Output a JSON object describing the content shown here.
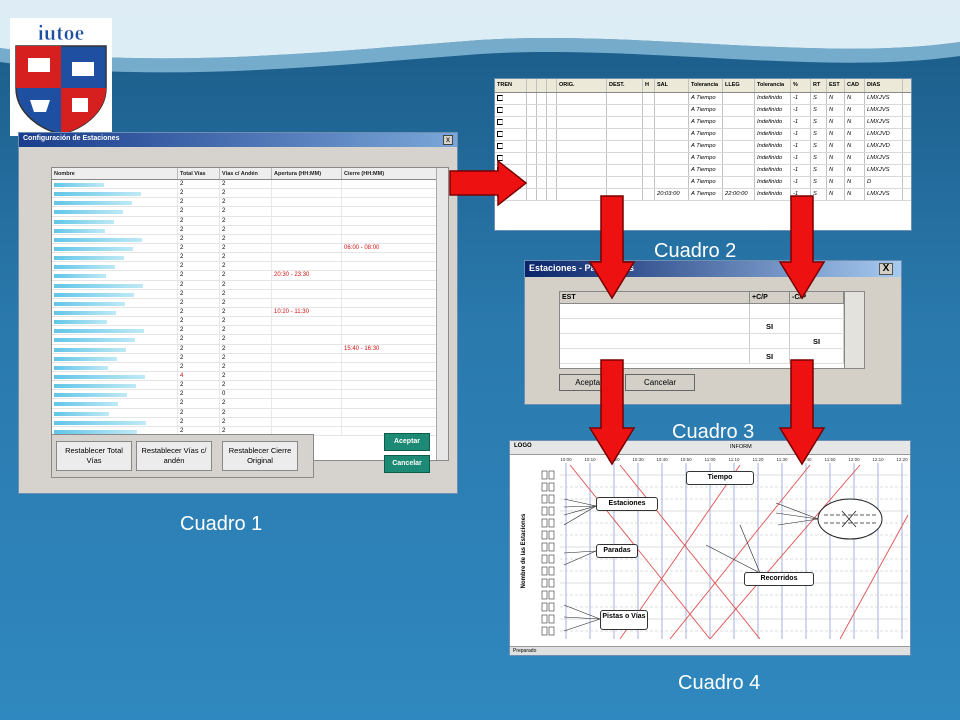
{
  "captions": {
    "c1": "Cuadro 1",
    "c2": "Cuadro 2",
    "c3": "Cuadro 3",
    "c4": "Cuadro 4"
  },
  "logo": {
    "text": "iutoe"
  },
  "cuadro1": {
    "title": "Configuración de Estaciones",
    "close_glyph": "x",
    "columns": [
      "Nombre",
      "Total Vías",
      "Vías c/ Andén",
      "Apertura (HH:MM)",
      "Cierre (HH:MM)"
    ],
    "rows": [
      {
        "total": "2",
        "via": "2",
        "apertura": "",
        "cierre": "",
        "red": false
      },
      {
        "total": "2",
        "via": "2",
        "apertura": "",
        "cierre": "",
        "red": false
      },
      {
        "total": "2",
        "via": "2",
        "apertura": "",
        "cierre": "",
        "red": false
      },
      {
        "total": "2",
        "via": "2",
        "apertura": "",
        "cierre": "",
        "red": false
      },
      {
        "total": "2",
        "via": "2",
        "apertura": "",
        "cierre": "",
        "red": false
      },
      {
        "total": "2",
        "via": "2",
        "apertura": "",
        "cierre": "",
        "red": false
      },
      {
        "total": "2",
        "via": "2",
        "apertura": "",
        "cierre": "",
        "red": false
      },
      {
        "total": "2",
        "via": "2",
        "apertura": "",
        "cierre": "06:00 - 08:00",
        "red": false
      },
      {
        "total": "2",
        "via": "2",
        "apertura": "",
        "cierre": "",
        "red": false
      },
      {
        "total": "2",
        "via": "2",
        "apertura": "",
        "cierre": "",
        "red": false
      },
      {
        "total": "2",
        "via": "2",
        "apertura": "20:30 - 23:30",
        "cierre": "",
        "red": false
      },
      {
        "total": "2",
        "via": "2",
        "apertura": "",
        "cierre": "",
        "red": false
      },
      {
        "total": "2",
        "via": "2",
        "apertura": "",
        "cierre": "",
        "red": false
      },
      {
        "total": "2",
        "via": "2",
        "apertura": "",
        "cierre": "",
        "red": false
      },
      {
        "total": "2",
        "via": "2",
        "apertura": "10:20 - 11:30",
        "cierre": "",
        "red": false
      },
      {
        "total": "2",
        "via": "2",
        "apertura": "",
        "cierre": "",
        "red": false
      },
      {
        "total": "2",
        "via": "2",
        "apertura": "",
        "cierre": "",
        "red": false
      },
      {
        "total": "2",
        "via": "2",
        "apertura": "",
        "cierre": "",
        "red": false
      },
      {
        "total": "2",
        "via": "2",
        "apertura": "",
        "cierre": "15:40 - 16:30",
        "red": false
      },
      {
        "total": "2",
        "via": "2",
        "apertura": "",
        "cierre": "",
        "red": false
      },
      {
        "total": "2",
        "via": "2",
        "apertura": "",
        "cierre": "",
        "red": false
      },
      {
        "total": "4",
        "via": "2",
        "apertura": "",
        "cierre": "",
        "red": true
      },
      {
        "total": "2",
        "via": "2",
        "apertura": "",
        "cierre": "",
        "red": false
      },
      {
        "total": "2",
        "via": "0",
        "apertura": "",
        "cierre": "",
        "red": false
      },
      {
        "total": "2",
        "via": "2",
        "apertura": "",
        "cierre": "",
        "red": false
      },
      {
        "total": "2",
        "via": "2",
        "apertura": "",
        "cierre": "",
        "red": false
      },
      {
        "total": "2",
        "via": "2",
        "apertura": "",
        "cierre": "",
        "red": false
      },
      {
        "total": "2",
        "via": "2",
        "apertura": "",
        "cierre": "",
        "red": false
      }
    ],
    "buttons": {
      "restablecer_total": "Restablecer Total Vías",
      "restablecer_vias": "Restablecer Vías c/ andén",
      "restablecer_cierre": "Restablecer Cierre Original",
      "aceptar": "Aceptar",
      "cancelar": "Cancelar"
    }
  },
  "cuadro2": {
    "columns": [
      "TREN",
      "",
      "",
      "",
      "ORIG.",
      "DEST.",
      "H",
      "SAL",
      "Tolerancia",
      "LLEG",
      "Tolerancia",
      "%",
      "RT",
      "EST",
      "CAD",
      "DIAS"
    ],
    "rows": [
      {
        "sal": "",
        "tol1": "A Tiempo",
        "lleg": "",
        "tol2": "Indefinido",
        "pct": "-1",
        "rt": "S",
        "est": "N",
        "cad": "N",
        "dias": "LMXJVS"
      },
      {
        "sal": "",
        "tol1": "A Tiempo",
        "lleg": "",
        "tol2": "Indefinido",
        "pct": "-1",
        "rt": "S",
        "est": "N",
        "cad": "N",
        "dias": "LMXJVS"
      },
      {
        "sal": "",
        "tol1": "A Tiempo",
        "lleg": "",
        "tol2": "Indefinido",
        "pct": "-1",
        "rt": "S",
        "est": "N",
        "cad": "N",
        "dias": "LMXJVS"
      },
      {
        "sal": "",
        "tol1": "A Tiempo",
        "lleg": "",
        "tol2": "Indefinido",
        "pct": "-1",
        "rt": "S",
        "est": "N",
        "cad": "N",
        "dias": "LMXJVD"
      },
      {
        "sal": "",
        "tol1": "A Tiempo",
        "lleg": "",
        "tol2": "Indefinido",
        "pct": "-1",
        "rt": "S",
        "est": "N",
        "cad": "N",
        "dias": "LMXJVD"
      },
      {
        "sal": "",
        "tol1": "A Tiempo",
        "lleg": "",
        "tol2": "Indefinido",
        "pct": "-1",
        "rt": "S",
        "est": "N",
        "cad": "N",
        "dias": "LMXJVS"
      },
      {
        "sal": "",
        "tol1": "A Tiempo",
        "lleg": "",
        "tol2": "Indefinido",
        "pct": "-1",
        "rt": "S",
        "est": "N",
        "cad": "N",
        "dias": "LMXJVS"
      },
      {
        "sal": "",
        "tol1": "A Tiempo",
        "lleg": "",
        "tol2": "Indefinido",
        "pct": "-1",
        "rt": "S",
        "est": "N",
        "cad": "N",
        "dias": "D"
      },
      {
        "sal": "20:03:00",
        "tol1": "A Tiempo",
        "lleg": "22:00:00",
        "tol2": "Indefinido",
        "pct": "-1",
        "rt": "S",
        "est": "N",
        "cad": "N",
        "dias": "LMXJVS"
      }
    ]
  },
  "cuadro3": {
    "title": "Estaciones - Parámetros",
    "close_glyph": "X",
    "columns": [
      "EST",
      "+C/P",
      "-C/P"
    ],
    "rows": [
      {
        "plus": "",
        "minus": ""
      },
      {
        "plus": "SI",
        "minus": ""
      },
      {
        "plus": "",
        "minus": "SI"
      },
      {
        "plus": "SI",
        "minus": ""
      }
    ],
    "aceptar": "Aceptar",
    "cancelar": "Cancelar"
  },
  "cuadro4": {
    "logo": "LOGO",
    "toolbar_label": "INFORM",
    "times": [
      "10:00",
      "10:10",
      "10:20",
      "10:30",
      "10:40",
      "10:50",
      "11:00",
      "11:10",
      "11:20",
      "11:30",
      "11:40",
      "11:50",
      "12:00",
      "12:10",
      "12:20"
    ],
    "ylabel": "Nombre de las Estaciones",
    "callouts": {
      "tiempo": "Tiempo",
      "estaciones": "Estaciones",
      "paradas": "Paradas",
      "recorridos": "Recorridos",
      "pistas": "Pistas o Vías"
    },
    "status": "Preparado"
  },
  "colors": {
    "arrow": "#ee1111",
    "accent": "#1c8a74"
  }
}
